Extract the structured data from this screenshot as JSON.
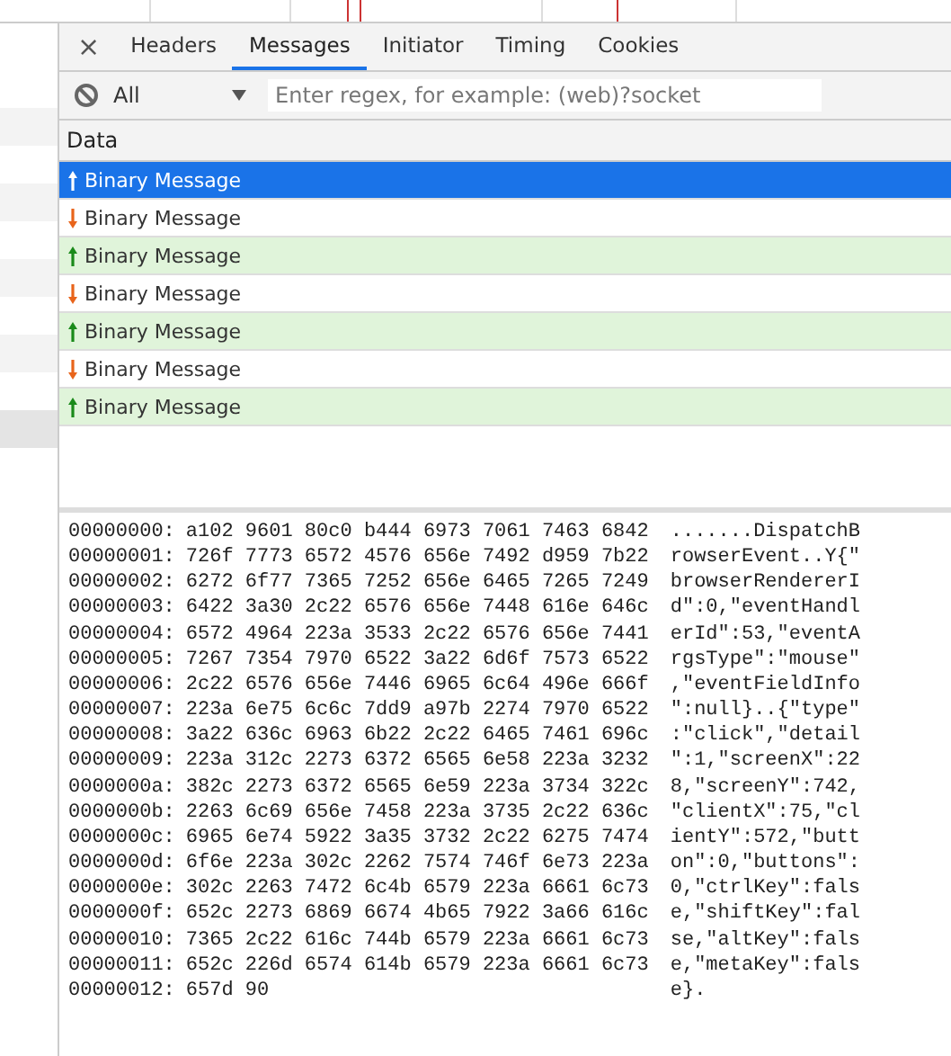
{
  "tabs": [
    {
      "label": "Headers",
      "selected": false
    },
    {
      "label": "Messages",
      "selected": true
    },
    {
      "label": "Initiator",
      "selected": false
    },
    {
      "label": "Timing",
      "selected": false
    },
    {
      "label": "Cookies",
      "selected": false
    }
  ],
  "close_button": "×",
  "filter": {
    "type_value": "All",
    "placeholder": "Enter regex, for example: (web)?socket"
  },
  "table": {
    "columns": [
      "Data"
    ],
    "rows": [
      {
        "kind": "sent",
        "text": "Binary Message",
        "selected": true
      },
      {
        "kind": "received",
        "text": "Binary Message",
        "selected": false
      },
      {
        "kind": "sent",
        "text": "Binary Message",
        "selected": false
      },
      {
        "kind": "received",
        "text": "Binary Message",
        "selected": false
      },
      {
        "kind": "sent",
        "text": "Binary Message",
        "selected": false
      },
      {
        "kind": "received",
        "text": "Binary Message",
        "selected": false
      },
      {
        "kind": "sent",
        "text": "Binary Message",
        "selected": false
      }
    ]
  },
  "hex_dump": [
    {
      "offset": "00000000:",
      "hex": "a102 9601 80c0 b444 6973 7061 7463 6842",
      "ascii": ".......DispatchB"
    },
    {
      "offset": "00000001:",
      "hex": "726f 7773 6572 4576 656e 7492 d959 7b22",
      "ascii": "rowserEvent..Y{\""
    },
    {
      "offset": "00000002:",
      "hex": "6272 6f77 7365 7252 656e 6465 7265 7249",
      "ascii": "browserRendererI"
    },
    {
      "offset": "00000003:",
      "hex": "6422 3a30 2c22 6576 656e 7448 616e 646c",
      "ascii": "d\":0,\"eventHandl"
    },
    {
      "offset": "00000004:",
      "hex": "6572 4964 223a 3533 2c22 6576 656e 7441",
      "ascii": "erId\":53,\"eventA"
    },
    {
      "offset": "00000005:",
      "hex": "7267 7354 7970 6522 3a22 6d6f 7573 6522",
      "ascii": "rgsType\":\"mouse\""
    },
    {
      "offset": "00000006:",
      "hex": "2c22 6576 656e 7446 6965 6c64 496e 666f",
      "ascii": ",\"eventFieldInfo"
    },
    {
      "offset": "00000007:",
      "hex": "223a 6e75 6c6c 7dd9 a97b 2274 7970 6522",
      "ascii": "\":null}..{\"type\""
    },
    {
      "offset": "00000008:",
      "hex": "3a22 636c 6963 6b22 2c22 6465 7461 696c",
      "ascii": ":\"click\",\"detail"
    },
    {
      "offset": "00000009:",
      "hex": "223a 312c 2273 6372 6565 6e58 223a 3232",
      "ascii": "\":1,\"screenX\":22"
    },
    {
      "offset": "0000000a:",
      "hex": "382c 2273 6372 6565 6e59 223a 3734 322c",
      "ascii": "8,\"screenY\":742,"
    },
    {
      "offset": "0000000b:",
      "hex": "2263 6c69 656e 7458 223a 3735 2c22 636c",
      "ascii": "\"clientX\":75,\"cl"
    },
    {
      "offset": "0000000c:",
      "hex": "6965 6e74 5922 3a35 3732 2c22 6275 7474",
      "ascii": "ientY\":572,\"butt"
    },
    {
      "offset": "0000000d:",
      "hex": "6f6e 223a 302c 2262 7574 746f 6e73 223a",
      "ascii": "on\":0,\"buttons\":"
    },
    {
      "offset": "0000000e:",
      "hex": "302c 2263 7472 6c4b 6579 223a 6661 6c73",
      "ascii": "0,\"ctrlKey\":fals"
    },
    {
      "offset": "0000000f:",
      "hex": "652c 2273 6869 6674 4b65 7922 3a66 616c",
      "ascii": "e,\"shiftKey\":fal"
    },
    {
      "offset": "00000010:",
      "hex": "7365 2c22 616c 744b 6579 223a 6661 6c73",
      "ascii": "se,\"altKey\":fals"
    },
    {
      "offset": "00000011:",
      "hex": "652c 226d 6574 614b 6579 223a 6661 6c73",
      "ascii": "e,\"metaKey\":fals"
    },
    {
      "offset": "00000012:",
      "hex": "657d 90",
      "ascii": "e}."
    }
  ]
}
